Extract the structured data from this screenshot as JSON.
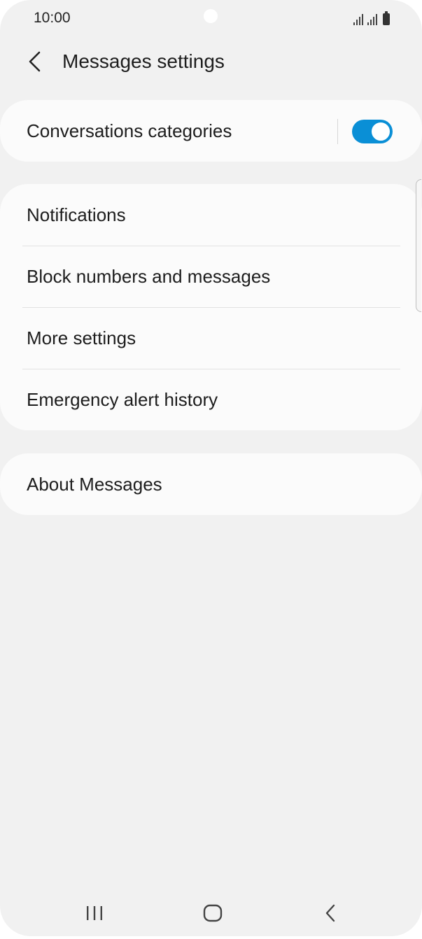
{
  "status_bar": {
    "time": "10:00",
    "icons": [
      "camera-cutout",
      "signal-icon",
      "signal-icon",
      "battery-icon"
    ]
  },
  "header": {
    "back_icon": "chevron-left-icon",
    "title": "Messages settings"
  },
  "card_top": {
    "label": "Conversations categories",
    "toggle_on": true,
    "accent_color": "#0a8fd6"
  },
  "card_main": {
    "items": [
      {
        "label": "Notifications"
      },
      {
        "label": "Block numbers and messages"
      },
      {
        "label": "More settings"
      },
      {
        "label": "Emergency alert history"
      }
    ]
  },
  "card_about": {
    "label": "About Messages"
  },
  "nav_bar": {
    "icons": [
      "recent-apps-icon",
      "home-icon",
      "back-icon"
    ]
  }
}
